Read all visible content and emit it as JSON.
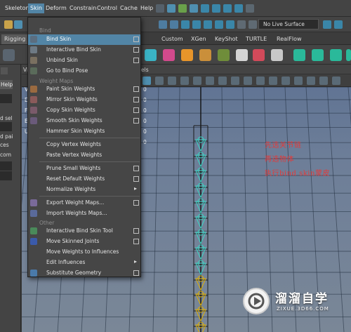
{
  "menubar": {
    "items": [
      "Skeleton",
      "Skin",
      "Deform",
      "Constrain",
      "Control",
      "Cache",
      "Help"
    ],
    "active": "Skin"
  },
  "toolbar": {
    "live_surface": "No Live Surface"
  },
  "shelf": {
    "tabs": [
      "Rigging",
      "Custom",
      "XGen",
      "KeyShot",
      "TURTLE",
      "RealFlow"
    ],
    "selected": "Rigging"
  },
  "left_panel": {
    "help_label": "Help",
    "fragments": [
      "d sel",
      "d pai",
      "ces",
      "com"
    ]
  },
  "viewport": {
    "header_fragment": "Vie",
    "panels_fragment": "els",
    "hud_values": [
      "0",
      "0",
      "0",
      "0",
      "0",
      "0"
    ],
    "hud_letters": [
      "V",
      "E",
      "F",
      "E",
      "U"
    ]
  },
  "skin_menu": {
    "sections": {
      "bind": "Bind",
      "weight_maps": "Weight Maps",
      "other": "Other"
    },
    "items": [
      {
        "label": "Bind Skin",
        "option": true,
        "highlighted": true,
        "icon": "bind-skin-icon"
      },
      {
        "label": "Interactive Bind Skin",
        "option": true,
        "icon": "interactive-bind-icon"
      },
      {
        "label": "Unbind Skin",
        "option": true,
        "icon": "unbind-skin-icon"
      },
      {
        "label": "Go to Bind Pose",
        "option": false,
        "icon": "bind-pose-icon"
      },
      {
        "label": "Paint Skin Weights",
        "option": true,
        "icon": "paint-weights-icon"
      },
      {
        "label": "Mirror Skin Weights",
        "option": true,
        "icon": "mirror-weights-icon"
      },
      {
        "label": "Copy Skin Weights",
        "option": true,
        "icon": "copy-weights-icon"
      },
      {
        "label": "Smooth Skin Weights",
        "option": true,
        "icon": "smooth-weights-icon"
      },
      {
        "label": "Hammer Skin Weights",
        "option": false,
        "icon": "hammer-weights-icon"
      },
      {
        "label": "Copy Vertex Weights",
        "option": false
      },
      {
        "label": "Paste Vertex Weights",
        "option": false
      },
      {
        "label": "Prune Small Weights",
        "option": true
      },
      {
        "label": "Reset Default Weights",
        "option": true
      },
      {
        "label": "Normalize Weights",
        "submenu": true
      },
      {
        "label": "Export Weight Maps...",
        "option": true,
        "icon": "export-maps-icon"
      },
      {
        "label": "Import Weights Maps...",
        "option": false,
        "icon": "import-maps-icon"
      },
      {
        "label": "Interactive Bind Skin Tool",
        "option": true,
        "icon": "bind-tool-icon"
      },
      {
        "label": "Move Skinned Joints",
        "option": true,
        "icon": "move-joints-icon"
      },
      {
        "label": "Move Weights to Influences",
        "option": false
      },
      {
        "label": "Edit Influences",
        "submenu": true
      },
      {
        "label": "Substitute Geometry",
        "option": true,
        "icon": "substitute-geometry-icon"
      }
    ]
  },
  "annotation": {
    "lines": [
      "先选关节链",
      "再选物体",
      "执行bind skin蒙皮"
    ],
    "color": "#e23a3a"
  },
  "watermark": {
    "title": "溜溜自学",
    "subtitle": "ZIXUE.3D66.COM"
  },
  "colors": {
    "menu_highlight": "#5285a6",
    "viewport_top": "#5d7192",
    "viewport_bottom": "#7a8797",
    "joint_outline": "#e0b000",
    "joint_fill": "#3ad6c4"
  }
}
